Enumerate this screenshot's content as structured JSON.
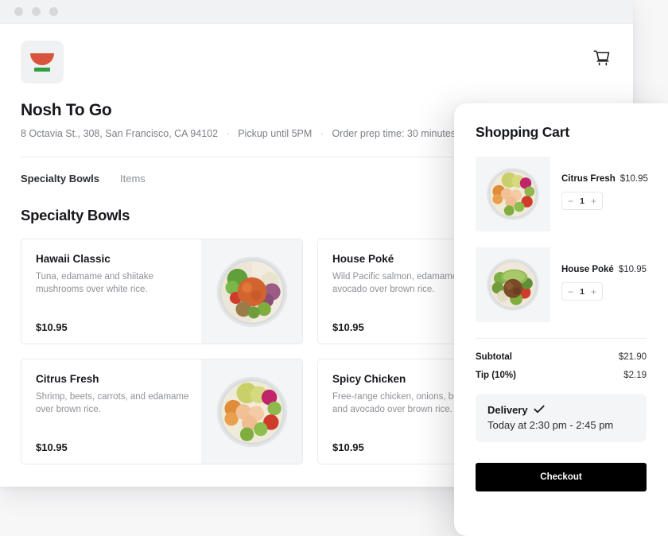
{
  "window": {
    "dots": [
      "minimize-dot",
      "maximize-dot",
      "close-dot"
    ]
  },
  "store": {
    "logo_icon": "bowl-logo-icon",
    "cart_icon": "shopping-cart-icon",
    "name": "Nosh To Go",
    "address": "8 Octavia St., 308, San Francisco, CA 94102",
    "pickup": "Pickup until 5PM",
    "prep": "Order prep time: 30 minutes",
    "separator": "·"
  },
  "tabs": [
    {
      "label": "Specialty Bowls",
      "active": true
    },
    {
      "label": "Items",
      "active": false
    }
  ],
  "menu": {
    "section_title": "Specialty Bowls",
    "items": [
      {
        "name": "Hawaii Classic",
        "description": "Tuna, edamame and shiitake mushrooms over white rice.",
        "price": "$10.95",
        "image": "hawaii-classic-bowl-photo"
      },
      {
        "name": "House Poké",
        "description": "Wild Pacific salmon, edamame and avocado over brown rice.",
        "price": "$10.95",
        "image": "house-poke-bowl-photo"
      },
      {
        "name": "Citrus Fresh",
        "description": "Shrimp, beets, carrots, and edamame over brown rice.",
        "price": "$10.95",
        "image": "citrus-fresh-bowl-photo"
      },
      {
        "name": "Spicy Chicken",
        "description": "Free-range chicken, onions, beets, and avocado over brown rice.",
        "price": "$10.95",
        "image": "spicy-chicken-bowl-photo"
      }
    ]
  },
  "cart": {
    "title": "Shopping Cart",
    "items": [
      {
        "name": "Citrus Fresh",
        "price": "$10.95",
        "quantity": "1",
        "image": "citrus-fresh-bowl-photo",
        "decrement": "−",
        "increment": "+"
      },
      {
        "name": "House Poké",
        "price": "$10.95",
        "quantity": "1",
        "image": "house-poke-bowl-photo",
        "decrement": "−",
        "increment": "+"
      }
    ],
    "totals": [
      {
        "label": "Subtotal",
        "value": "$21.90"
      },
      {
        "label": "Tip (10%)",
        "value": "$2.19"
      }
    ],
    "delivery": {
      "label": "Delivery",
      "check_icon": "checkmark-icon",
      "time": "Today at 2:30 pm - 2:45 pm"
    },
    "checkout_label": "Checkout"
  },
  "colors": {
    "logo_bowl": "#d9543f",
    "logo_base": "#2e9e3e",
    "checkout_bg": "#000000",
    "panel_bg": "#ffffff",
    "media_bg": "#f4f5f6"
  }
}
